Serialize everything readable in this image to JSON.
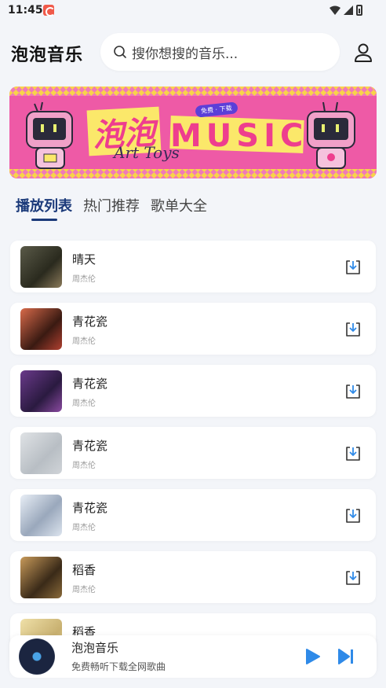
{
  "status_bar": {
    "time": "11:45"
  },
  "header": {
    "app_title": "泡泡音乐",
    "search_placeholder": "搜你想搜的音乐..."
  },
  "banner": {
    "cn_text": "泡泡",
    "en_text": "MUSIC",
    "sub_text": "Art Toys",
    "pill_text": "免费 · 下载",
    "colors": {
      "background": "#ee5aa6",
      "accent": "#fbe86a"
    }
  },
  "tabs": [
    {
      "label": "播放列表",
      "active": true
    },
    {
      "label": "热门推荐",
      "active": false
    },
    {
      "label": "歌单大全",
      "active": false
    }
  ],
  "songs": [
    {
      "title": "晴天",
      "artist": "周杰伦",
      "cover_color": "#3a3a2a"
    },
    {
      "title": "青花瓷",
      "artist": "周杰伦",
      "cover_color": "#6a2a1e"
    },
    {
      "title": "青花瓷",
      "artist": "周杰伦",
      "cover_color": "#3a2050"
    },
    {
      "title": "青花瓷",
      "artist": "周杰伦",
      "cover_color": "#c9ced3"
    },
    {
      "title": "青花瓷",
      "artist": "周杰伦",
      "cover_color": "#b7c4d6"
    },
    {
      "title": "稻香",
      "artist": "周杰伦",
      "cover_color": "#7a5a2a"
    },
    {
      "title": "稻香",
      "artist": "",
      "cover_color": "#e3cf8e"
    }
  ],
  "player": {
    "title": "泡泡音乐",
    "subtitle": "免费畅听下载全网歌曲",
    "accent_color": "#2f8ae8"
  }
}
